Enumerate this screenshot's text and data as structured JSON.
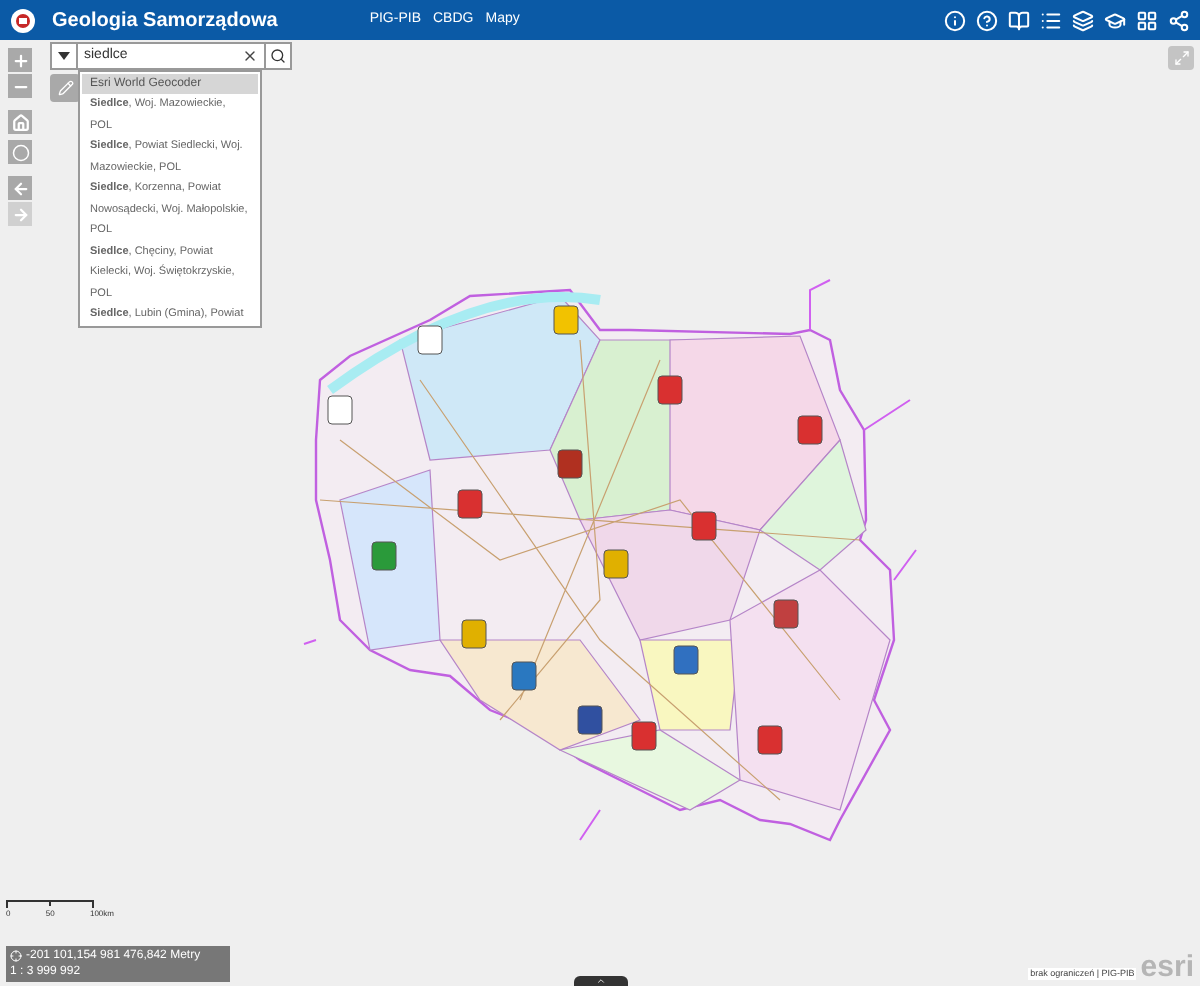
{
  "header": {
    "title": "Geologia Samorządowa",
    "links": [
      "PIG-PIB",
      "CBDG",
      "Mapy"
    ]
  },
  "search": {
    "value": "siedlce",
    "results": [
      {
        "text": "Esri World Geocoder",
        "kind": "source",
        "selected": true
      },
      {
        "text": "**Siedlce**, Woj. Mazowieckie, POL",
        "kind": "result",
        "selected": false
      },
      {
        "text": "**Siedlce**, Powiat Siedlecki, Woj. Mazowieckie, POL",
        "kind": "result",
        "selected": false
      },
      {
        "text": "**Siedlce**, Korzenna, Powiat Nowosądecki, Woj. Małopolskie, POL",
        "kind": "result",
        "selected": false
      },
      {
        "text": "**Siedlce**, Chęciny, Powiat Kielecki, Woj. Świętokrzyskie, POL",
        "kind": "result",
        "selected": false
      },
      {
        "text": "**Siedlce**, Lubin (Gmina), Powiat",
        "kind": "result",
        "selected": false
      }
    ]
  },
  "scale_bar": {
    "labels": [
      "0",
      "50",
      "100km"
    ]
  },
  "coordinates": {
    "position": "-201 101,154 981 476,842 Metry",
    "scale": "1 : 3 999 992"
  },
  "attribution": {
    "text": "brak ograniczeń | PIG-PIB",
    "logo": "esri"
  }
}
